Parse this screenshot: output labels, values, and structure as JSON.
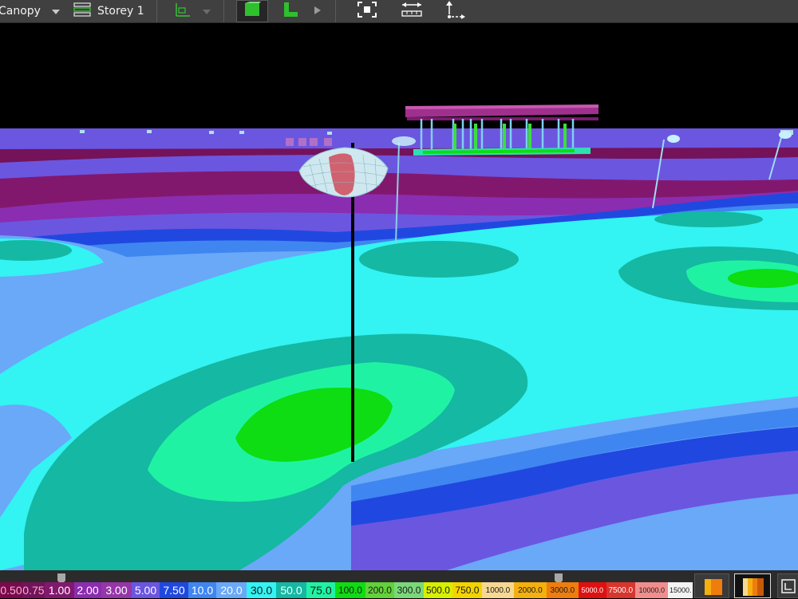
{
  "toolbar": {
    "layer_label": "Canopy",
    "storey_label": "Storey 1",
    "colors": {
      "green": "#2fbf2f",
      "bg": "#404040"
    }
  },
  "legend": {
    "swatches": [
      {
        "label": "0.50",
        "color": "#7a0a4c",
        "text": "#f2b5d2"
      },
      {
        "label": "0.75",
        "color": "#74125a",
        "text": "#f2b5d2"
      },
      {
        "label": "1.00",
        "color": "#82186e",
        "text": "#ffffff"
      },
      {
        "label": "2.00",
        "color": "#8a2db0",
        "text": "#ffffff"
      },
      {
        "label": "3.00",
        "color": "#9636a8",
        "text": "#ffffff"
      },
      {
        "label": "5.00",
        "color": "#6b56e0",
        "text": "#ffffff"
      },
      {
        "label": "7.50",
        "color": "#2048e0",
        "text": "#ffffff"
      },
      {
        "label": "10.0",
        "color": "#3f86f0",
        "text": "#ffffff"
      },
      {
        "label": "20.0",
        "color": "#6aa8f8",
        "text": "#ffffff"
      },
      {
        "label": "30.0",
        "color": "#33f3f3",
        "text": "#1a1a1a"
      },
      {
        "label": "50.0",
        "color": "#15b8a2",
        "text": "#ffffff"
      },
      {
        "label": "75.0",
        "color": "#1ff3a3",
        "text": "#1a1a1a"
      },
      {
        "label": "100.0",
        "color": "#0ddd12",
        "text": "#1a1a1a"
      },
      {
        "label": "200.0",
        "color": "#62d13a",
        "text": "#1a1a1a"
      },
      {
        "label": "300.0",
        "color": "#7ad87a",
        "text": "#1a1a1a"
      },
      {
        "label": "500.0",
        "color": "#d6f000",
        "text": "#1a1a1a"
      },
      {
        "label": "750.0",
        "color": "#f4d400",
        "text": "#1a1a1a"
      },
      {
        "label": "1000.0",
        "color": "#f6d893",
        "text": "#1a1a1a"
      },
      {
        "label": "2000.0",
        "color": "#f4b00f",
        "text": "#1a1a1a"
      },
      {
        "label": "3000.0",
        "color": "#ee7d0e",
        "text": "#1a1a1a"
      },
      {
        "label": "5000.0",
        "color": "#e01010",
        "text": "#ffffff"
      },
      {
        "label": "7500.0",
        "color": "#d8352d",
        "text": "#ffffff"
      },
      {
        "label": "10000.0",
        "color": "#f08e8e",
        "text": "#1a1a1a"
      },
      {
        "label": "15000.",
        "color": "#f2f2f2",
        "text": "#1a1a1a"
      }
    ]
  }
}
